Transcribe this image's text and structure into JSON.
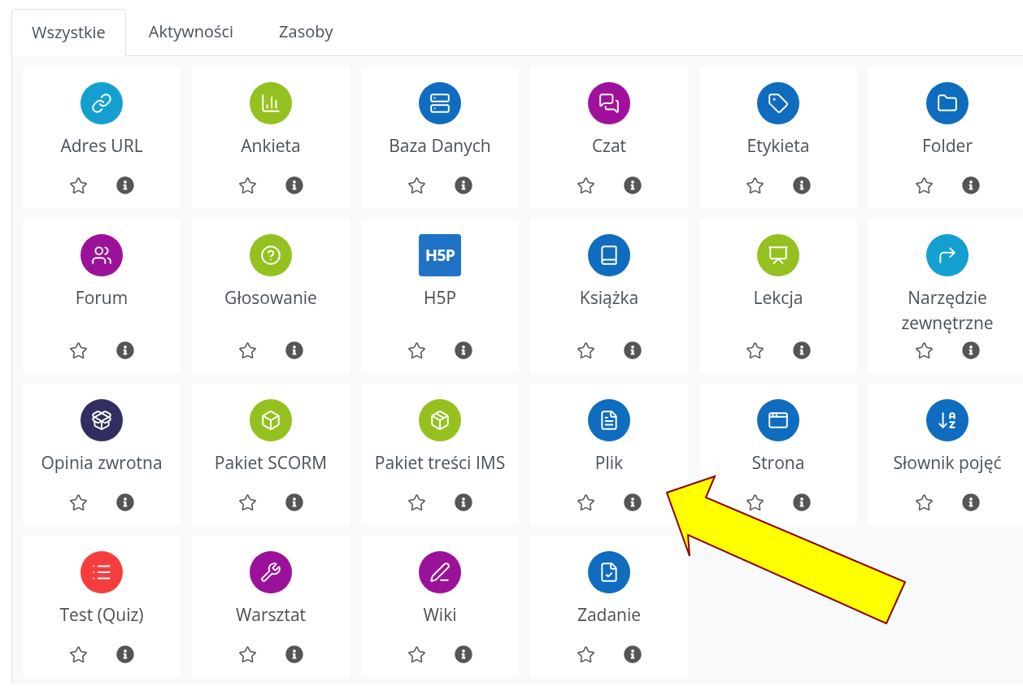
{
  "tabs": [
    {
      "label": "Wszystkie",
      "selected": true
    },
    {
      "label": "Aktywności",
      "selected": false
    },
    {
      "label": "Zasoby",
      "selected": false
    }
  ],
  "modules": [
    {
      "name": "Adres URL",
      "kind": "circle",
      "color": "#13a0d0"
    },
    {
      "name": "Ankieta",
      "kind": "circle",
      "color": "#94c11f"
    },
    {
      "name": "Baza Danych",
      "kind": "circle",
      "color": "#0f6cbf"
    },
    {
      "name": "Czat",
      "kind": "circle",
      "color": "#a0109c"
    },
    {
      "name": "Etykieta",
      "kind": "circle",
      "color": "#0f6cbf"
    },
    {
      "name": "Folder",
      "kind": "circle",
      "color": "#0f6cbf"
    },
    {
      "name": "Forum",
      "kind": "circle",
      "color": "#9b1199"
    },
    {
      "name": "Głosowanie",
      "kind": "circle",
      "color": "#94c11f"
    },
    {
      "name": "H5P",
      "kind": "logo",
      "color": "#1f73c7",
      "logo_text": "H5P"
    },
    {
      "name": "Książka",
      "kind": "circle",
      "color": "#0f6cbf"
    },
    {
      "name": "Lekcja",
      "kind": "circle",
      "color": "#94c11f"
    },
    {
      "name": "Narzędzie zewnętrzne",
      "kind": "circle",
      "color": "#13a0d0"
    },
    {
      "name": "Opinia zwrotna",
      "kind": "circle",
      "color": "#312f61"
    },
    {
      "name": "Pakiet SCORM",
      "kind": "circle",
      "color": "#94c11f"
    },
    {
      "name": "Pakiet treści IMS",
      "kind": "circle",
      "color": "#94c11f"
    },
    {
      "name": "Plik",
      "kind": "circle",
      "color": "#0f6cbf"
    },
    {
      "name": "Strona",
      "kind": "circle",
      "color": "#0f6cbf"
    },
    {
      "name": "Słownik pojęć",
      "kind": "circle",
      "color": "#0f6cbf"
    },
    {
      "name": "Test (Quiz)",
      "kind": "circle",
      "color": "#f63d3d"
    },
    {
      "name": "Warsztat",
      "kind": "circle",
      "color": "#9b1199"
    },
    {
      "name": "Wiki",
      "kind": "circle",
      "color": "#9b1199"
    },
    {
      "name": "Zadanie",
      "kind": "circle",
      "color": "#0f6cbf"
    }
  ]
}
